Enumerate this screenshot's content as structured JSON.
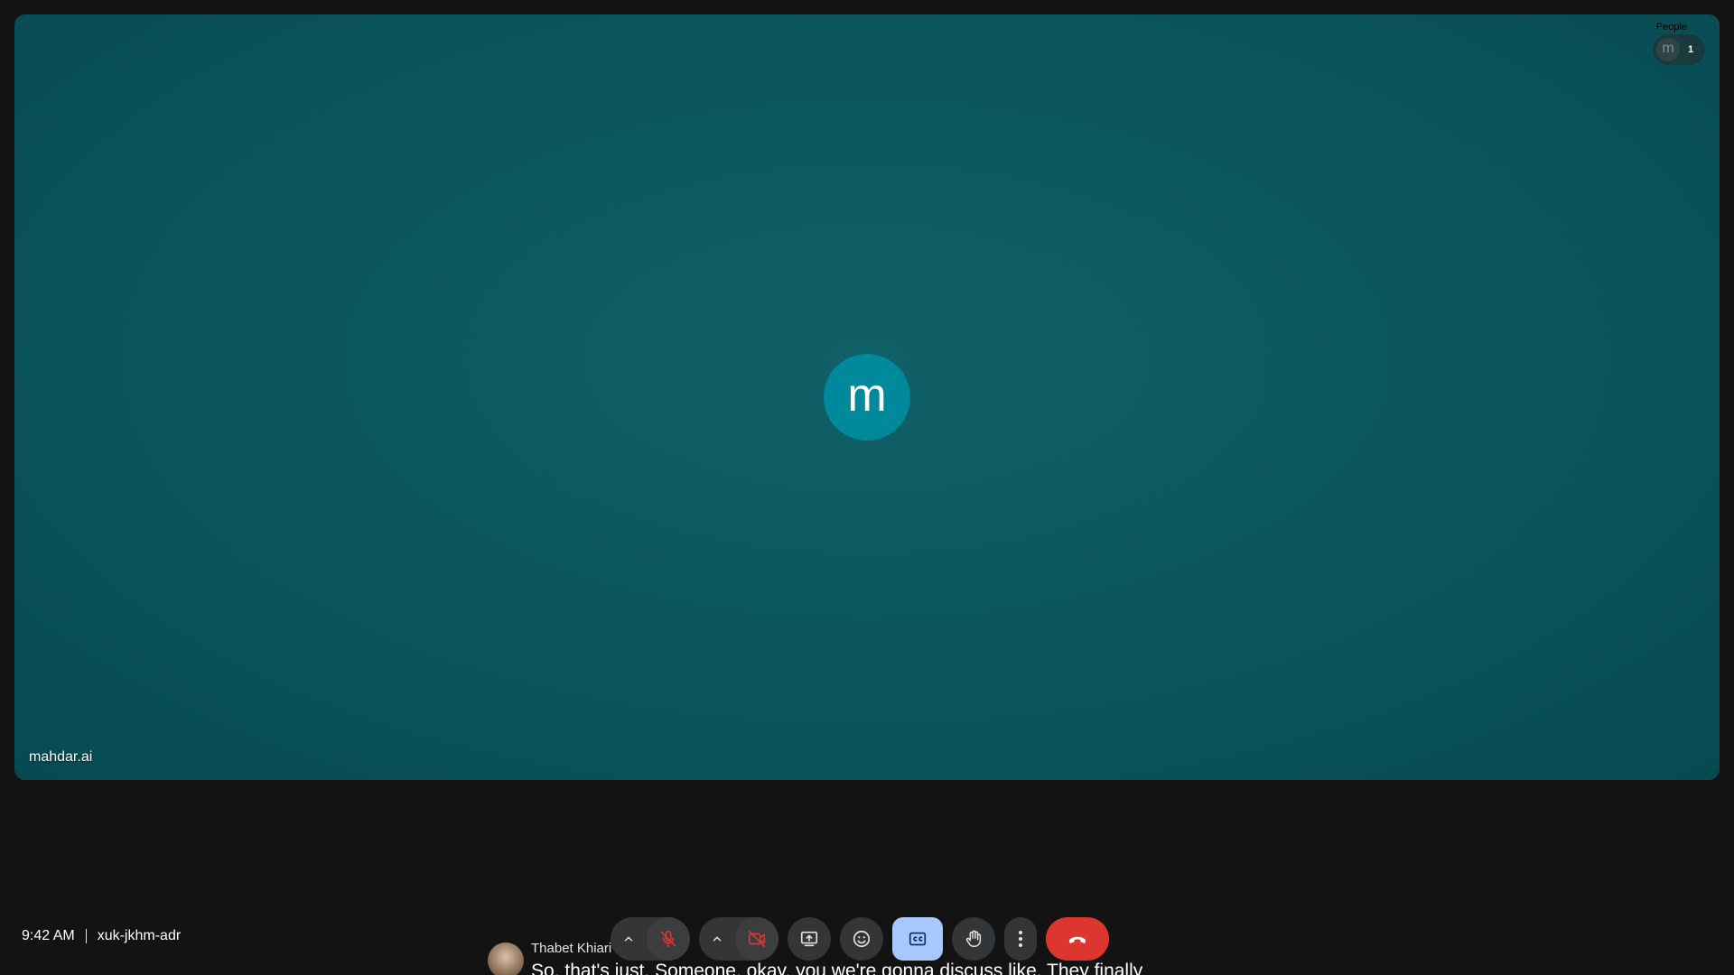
{
  "tile": {
    "avatar_initial": "m",
    "participant_name": "mahdar.ai",
    "background_color": "#0b555d",
    "avatar_color": "#00899b"
  },
  "people": {
    "label": "People",
    "avatar_initial": "m",
    "count": "1"
  },
  "meeting": {
    "time": "9:42 AM",
    "code": "xuk-jkhm-adr"
  },
  "controls": {
    "audio_options_icon": "chevron-up-icon",
    "mic_icon": "mic-off-icon",
    "video_options_icon": "chevron-up-icon",
    "camera_icon": "videocam-off-icon",
    "present_icon": "present-screen-icon",
    "reactions_icon": "emoji-icon",
    "captions_icon": "closed-caption-icon",
    "raise_hand_icon": "raise-hand-icon",
    "more_icon": "more-vertical-icon",
    "leave_icon": "call-end-icon",
    "accent_color": "#a8c7fa",
    "end_call_color": "#dc362e",
    "muted_color": "#dc362e"
  },
  "caption": {
    "speaker": "Thabet Khiari",
    "text": "So, that's just. Someone, okay, you we're gonna discuss like. They finally"
  }
}
